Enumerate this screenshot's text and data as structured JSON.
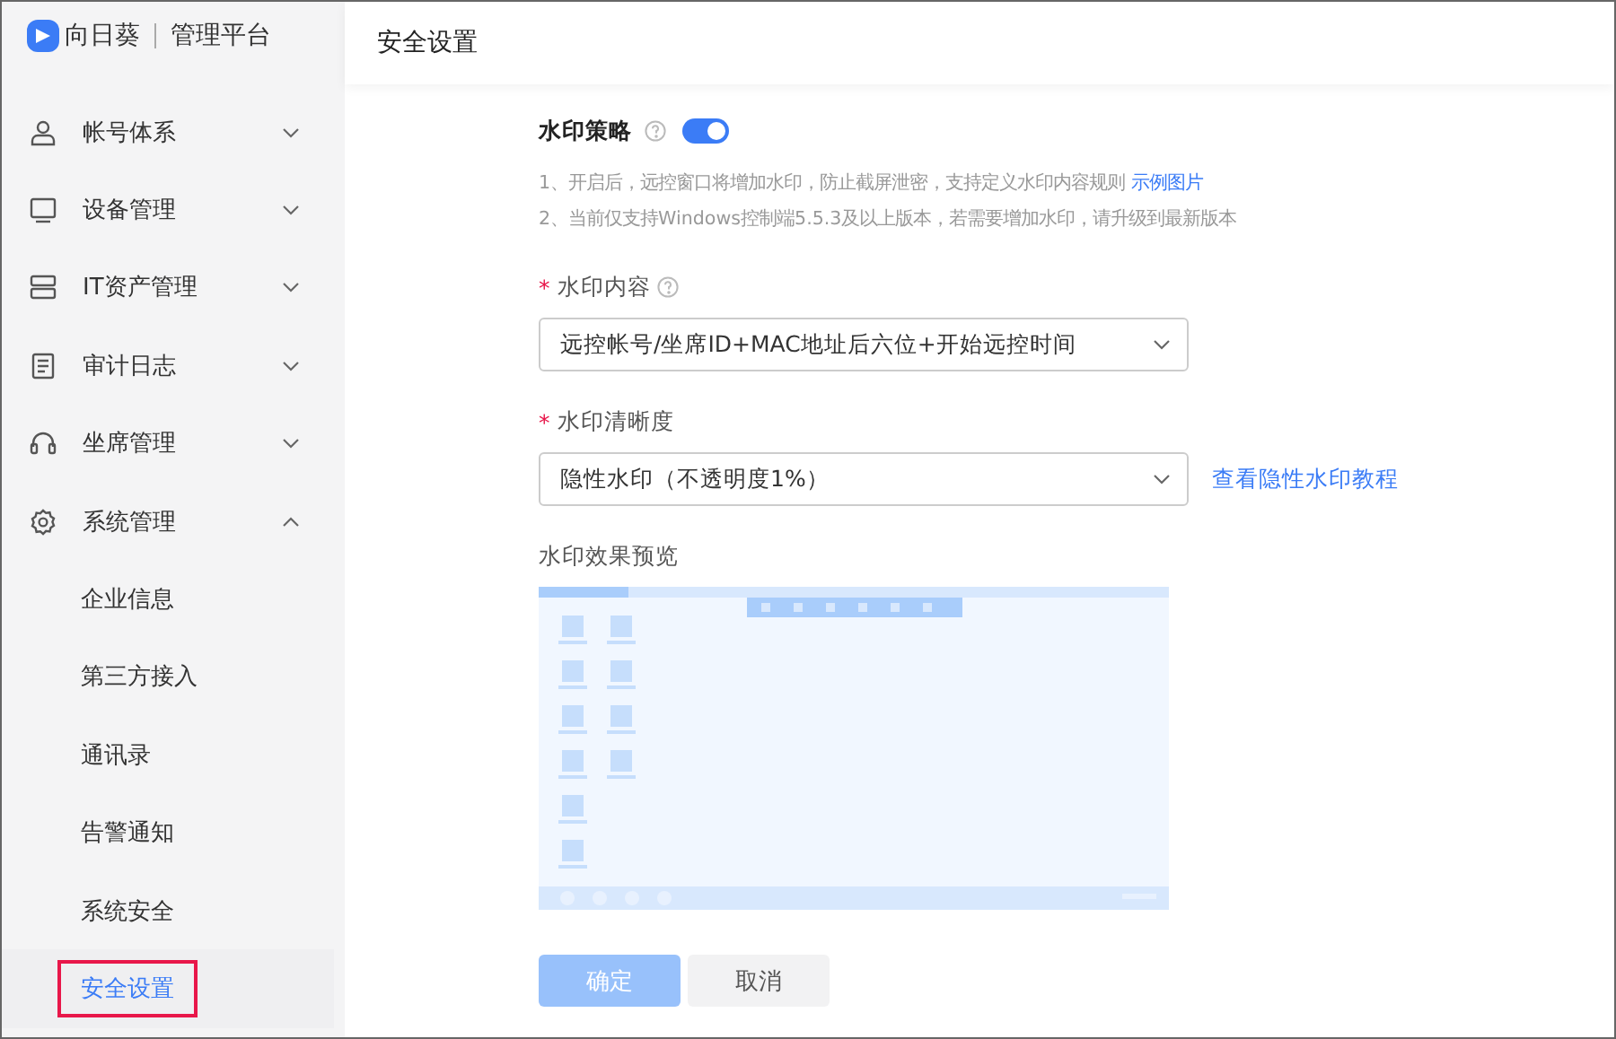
{
  "logo": {
    "brand": "向日葵",
    "product": "管理平台"
  },
  "page_title": "安全设置",
  "sidebar": {
    "items": [
      {
        "label": "帐号体系",
        "expanded": false
      },
      {
        "label": "设备管理",
        "expanded": false
      },
      {
        "label": "IT资产管理",
        "expanded": false
      },
      {
        "label": "审计日志",
        "expanded": false
      },
      {
        "label": "坐席管理",
        "expanded": false
      },
      {
        "label": "系统管理",
        "expanded": true,
        "children": [
          {
            "label": "企业信息",
            "selected": false
          },
          {
            "label": "第三方接入",
            "selected": false
          },
          {
            "label": "通讯录",
            "selected": false
          },
          {
            "label": "告警通知",
            "selected": false
          },
          {
            "label": "系统安全",
            "selected": false
          },
          {
            "label": "安全设置",
            "selected": true
          }
        ]
      }
    ]
  },
  "watermark": {
    "label": "水印策略",
    "on": true,
    "notes": [
      "1、开启后，远控窗口将增加水印，防止截屏泄密，支持定义水印内容规则",
      "2、当前仅支持Windows控制端5.5.3及以上版本，若需要增加水印，请升级到最新版本"
    ],
    "notes_link": "示例图片"
  },
  "content_field": {
    "required_mark": "*",
    "label": "水印内容",
    "value": "远控帐号/坐席ID+MAC地址后六位+开始远控时间"
  },
  "clarity_field": {
    "required_mark": "*",
    "label": "水印清晰度",
    "value": "隐性水印（不透明度1%）",
    "link": "查看隐性水印教程"
  },
  "preview_label": "水印效果预览",
  "buttons": [
    {
      "label": "确定",
      "kind": "primary",
      "disabled": true
    },
    {
      "label": "取消",
      "kind": "default",
      "disabled": false
    }
  ]
}
